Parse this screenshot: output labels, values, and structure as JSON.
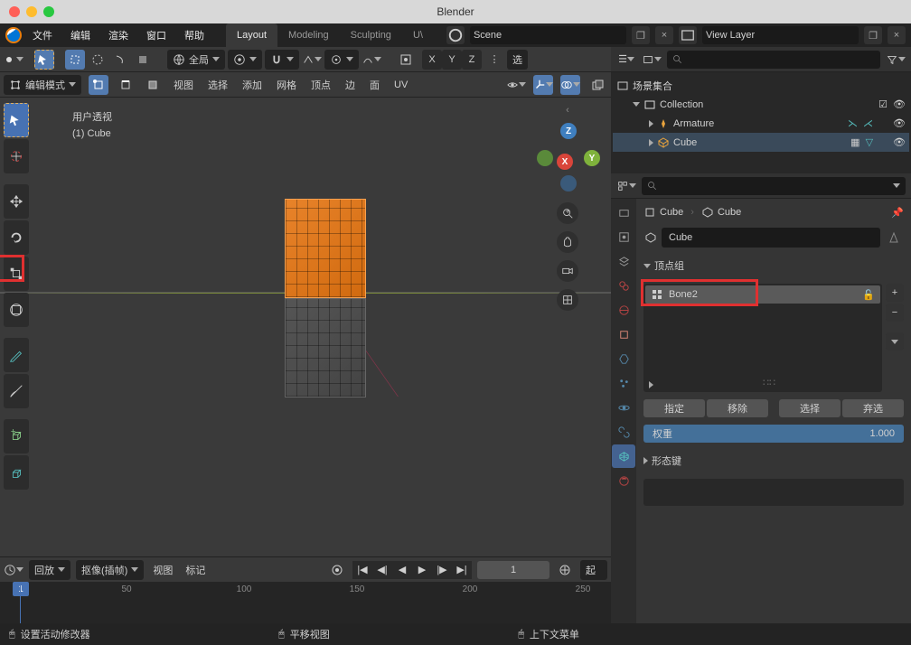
{
  "window": {
    "title": "Blender"
  },
  "menus": {
    "file": "文件",
    "edit": "编辑",
    "render": "渲染",
    "window": "窗口",
    "help": "帮助"
  },
  "workspaces": {
    "layout": "Layout",
    "modeling": "Modeling",
    "sculpting": "Sculpting",
    "uv": "U\\"
  },
  "scene": "Scene",
  "view_layer": "View Layer",
  "header": {
    "global": "全局",
    "select_txt": "选"
  },
  "mode": "编辑模式",
  "viewport_menus": {
    "view": "视图",
    "select": "选择",
    "add": "添加",
    "mesh": "网格",
    "vertex": "顶点",
    "edge": "边",
    "face": "面",
    "uv": "UV"
  },
  "viewport_info": {
    "persp": "用户透视",
    "obj": "(1) Cube"
  },
  "axes": {
    "x": "X",
    "y": "Y",
    "z": "Z"
  },
  "timeline": {
    "playback": "回放",
    "keying": "抠像(插帧)",
    "view": "视图",
    "marker": "标记",
    "frame": "1",
    "start_lbl": "起"
  },
  "tl_ticks": {
    "t1": "1",
    "t50": "50",
    "t100": "100",
    "t150": "150",
    "t200": "200",
    "t250": "250"
  },
  "outliner": {
    "scene_collection": "场景集合",
    "collection": "Collection",
    "armature": "Armature",
    "cube": "Cube"
  },
  "props": {
    "bc_cube1": "Cube",
    "bc_cube2": "Cube",
    "obj_name": "Cube",
    "panel_vg": "顶点组",
    "vg_item": "Bone2",
    "assign": "指定",
    "remove": "移除",
    "select": "选择",
    "deselect": "弃选",
    "weight_lbl": "权重",
    "weight_val": "1.000",
    "panel_sk": "形态键"
  },
  "status": {
    "left": "设置活动修改器",
    "mid": "平移视图",
    "right": "上下文菜单"
  }
}
